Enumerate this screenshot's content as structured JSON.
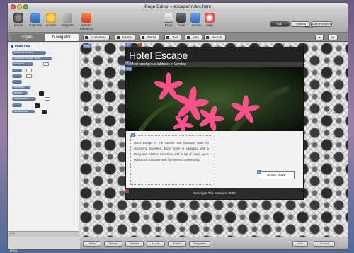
{
  "window": {
    "title": "Page Editor – escape/index.html"
  },
  "toolbar": {
    "left_buttons": [
      {
        "label": "Media",
        "icon": "media-icon"
      },
      {
        "label": "Inspector",
        "icon": "inspector-icon"
      },
      {
        "label": "Actions",
        "icon": "actions-icon"
      },
      {
        "label": "Snippets",
        "icon": "snippets-icon"
      },
      {
        "label": "Master Elements",
        "icon": "master-elements-icon"
      }
    ],
    "center_buttons": [
      {
        "label": "Page",
        "icon": "page-icon"
      },
      {
        "label": "Code",
        "icon": "code-icon"
      },
      {
        "label": "Layouts",
        "icon": "layouts-icon"
      },
      {
        "label": "Help",
        "icon": "help-icon"
      }
    ],
    "modes": {
      "items": [
        "Edit",
        "Preview",
        "Live Preview"
      ],
      "selected": "Edit",
      "label": "Mode"
    }
  },
  "secondbar": {
    "tabs": [
      "Styles",
      "Navigator"
    ],
    "selected_tab": "Navigator",
    "chips": [
      "Containers",
      "Forms",
      "Media",
      "Text",
      "Misc",
      "Partials"
    ]
  },
  "sidebar": {
    "root_file": "main.css",
    "styles": [
      "bookmarkbutton",
      "bookmarkbutton hover",
      "bodytext",
      "",
      "",
      "",
      "newstyle",
      "myrow",
      "#mycontent",
      "",
      "#bottombar"
    ],
    "bottom_label": "HTML"
  },
  "site": {
    "title": "Hotel Escape",
    "tagline": "Most prestigious address in London",
    "description": "Hotel Escape is the number one boutique hotel for discerning travellers. Every room is equipped with a Bang and Olufsen television, and is top-of-range Apple Macintosh computer with free internet connectivity.",
    "book_button": "BOOK NOW",
    "footer": "Copyright The Escapers 2009"
  },
  "statusbar": {
    "buttons": [
      "Save",
      "Revert",
      "Preview",
      "Mode",
      "Bottom",
      "Templates"
    ],
    "right_items": [
      "Unit",
      "Source"
    ]
  },
  "colors": {
    "selection_badge": "#5b7fc0",
    "warning_badge": "#c03a3a",
    "flower_pink": "#ff4f8a"
  }
}
